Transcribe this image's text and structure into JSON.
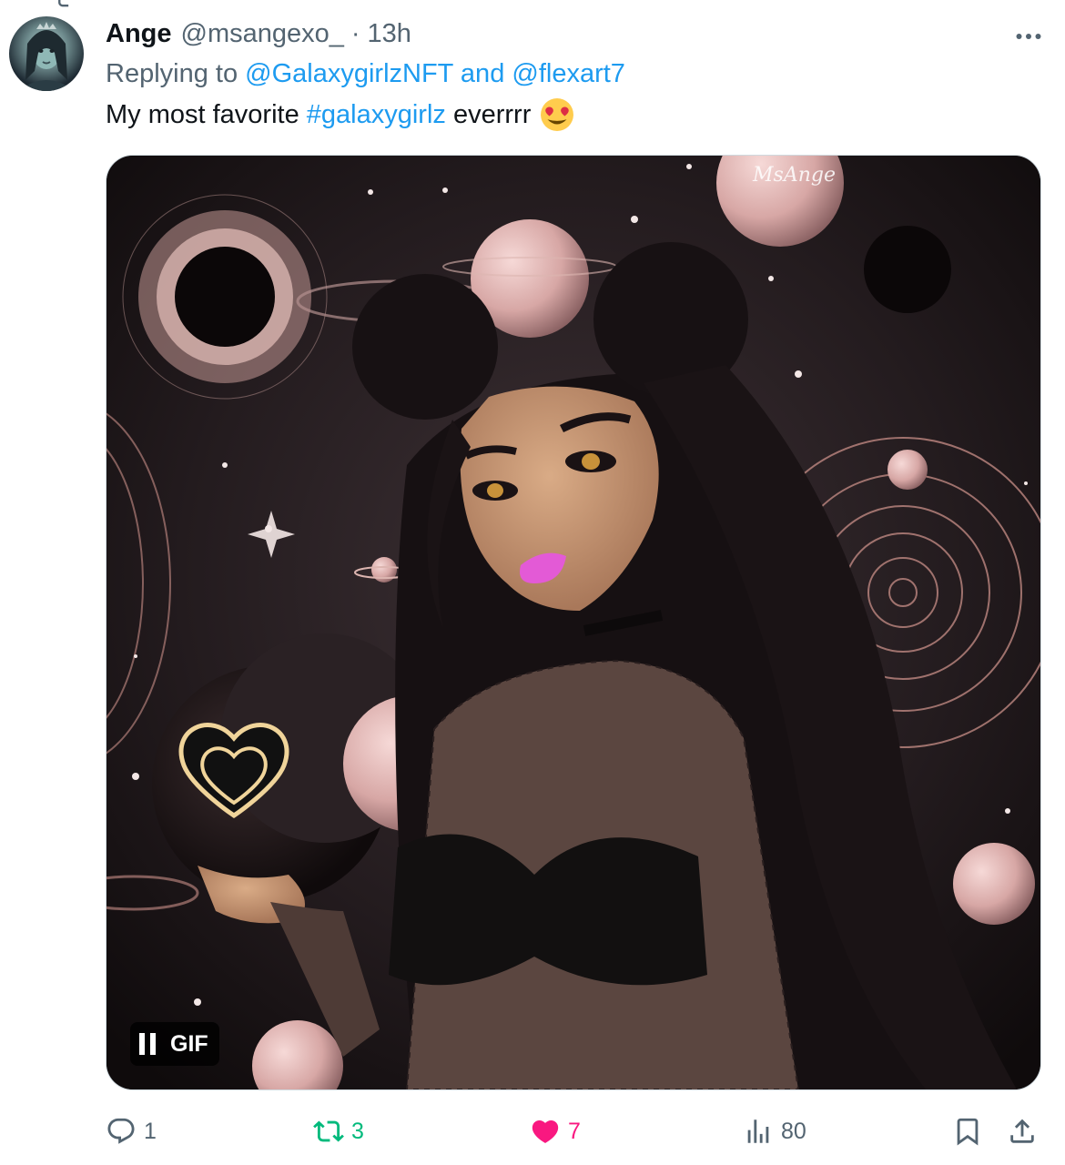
{
  "tweet": {
    "author_name": "Ange",
    "handle": "@msangexo_",
    "separator": "·",
    "timestamp": "13h",
    "reply_prefix": "Replying to ",
    "reply_mention_1": "@GalaxygirlzNFT",
    "reply_and": " and ",
    "reply_mention_2": "@flexart7",
    "text_before": "My most favorite ",
    "hashtag": "#galaxygirlz",
    "text_after": " everrrr",
    "emoji_name": "heart-eyes-emoji"
  },
  "media": {
    "badge_label": "GIF",
    "badge_icon": "pause-icon",
    "watermark": "MsAnge"
  },
  "actions": {
    "replies": "1",
    "reposts": "3",
    "likes": "7",
    "views": "80"
  },
  "colors": {
    "link": "#1d9bf0",
    "repost_active": "#00ba7c",
    "like_active": "#f91880",
    "muted": "#536471"
  }
}
